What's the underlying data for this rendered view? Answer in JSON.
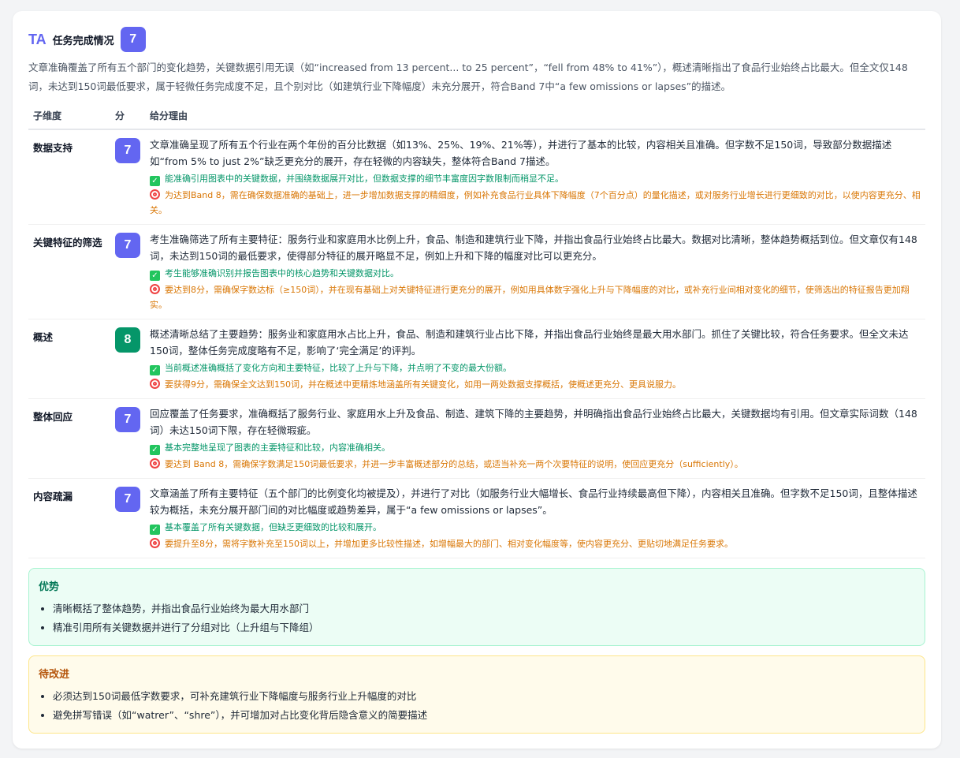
{
  "header": {
    "icon": "TA",
    "title": "任务完成情况",
    "score": "7"
  },
  "summary": "文章准确覆盖了所有五个部门的变化趋势，关键数据引用无误（如“increased from 13 percent... to 25 percent”，“fell from 48% to 41%”），概述清晰指出了食品行业始终占比最大。但全文仅148词，未达到150词最低要求，属于轻微任务完成度不足，且个别对比（如建筑行业下降幅度）未充分展开，符合Band 7中“a few omissions or lapses”的描述。",
  "table": {
    "columns": [
      "子维度",
      "分",
      "给分理由"
    ],
    "rows": [
      {
        "dimension": "数据支持",
        "score": "7",
        "reason": "文章准确呈现了所有五个行业在两个年份的百分比数据（如13%、25%、19%、21%等），并进行了基本的比较，内容相关且准确。但字数不足150词，导致部分数据描述如“from 5% to just 2%”缺乏更充分的展开，存在轻微的内容缺失，整体符合Band 7描述。",
        "strength": "能准确引用图表中的关键数据，并围绕数据展开对比，但数据支撑的细节丰富度因字数限制而稍显不足。",
        "tip": "为达到Band 8，需在确保数据准确的基础上，进一步增加数据支撑的精细度，例如补充食品行业具体下降幅度（7个百分点）的量化描述，或对服务行业增长进行更细致的对比，以使内容更充分、相关。"
      },
      {
        "dimension": "关键特征的筛选",
        "score": "7",
        "reason": "考生准确筛选了所有主要特征：服务行业和家庭用水比例上升，食品、制造和建筑行业下降，并指出食品行业始终占比最大。数据对比清晰，整体趋势概括到位。但文章仅有148词，未达到150词的最低要求，使得部分特征的展开略显不足，例如上升和下降的幅度对比可以更充分。",
        "strength": "考生能够准确识别并报告图表中的核心趋势和关键数据对比。",
        "tip": "要达到8分，需确保字数达标（≥150词），并在现有基础上对关键特征进行更充分的展开，例如用具体数字强化上升与下降幅度的对比，或补充行业间相对变化的细节，使筛选出的特征报告更加翔实。"
      },
      {
        "dimension": "概述",
        "score": "8",
        "reason": "概述清晰总结了主要趋势：服务业和家庭用水占比上升，食品、制造和建筑行业占比下降，并指出食品行业始终是最大用水部门。抓住了关键比较，符合任务要求。但全文未达150词，整体任务完成度略有不足，影响了‘完全满足’的评判。",
        "strength": "当前概述准确概括了变化方向和主要特征，比较了上升与下降，并点明了不变的最大份额。",
        "tip": "要获得9分，需确保全文达到150词，并在概述中更精炼地涵盖所有关键变化，如用一两处数据支撑概括，使概述更充分、更具说服力。"
      },
      {
        "dimension": "整体回应",
        "score": "7",
        "reason": "回应覆盖了任务要求，准确概括了服务行业、家庭用水上升及食品、制造、建筑下降的主要趋势，并明确指出食品行业始终占比最大，关键数据均有引用。但文章实际词数（148词）未达150词下限，存在轻微瑕疵。",
        "strength": "基本完整地呈现了图表的主要特征和比较，内容准确相关。",
        "tip": "要达到 Band 8，需确保字数满足150词最低要求，并进一步丰富概述部分的总结，或适当补充一两个次要特征的说明，使回应更充分（sufficiently）。"
      },
      {
        "dimension": "内容疏漏",
        "score": "7",
        "reason": "文章涵盖了所有主要特征（五个部门的比例变化均被提及），并进行了对比（如服务行业大幅增长、食品行业持续最高但下降），内容相关且准确。但字数不足150词，且整体描述较为概括，未充分展开部门间的对比幅度或趋势差异，属于“a few omissions or lapses”。",
        "strength": "基本覆盖了所有关键数据，但缺乏更细致的比较和展开。",
        "tip": "要提升至8分，需将字数补充至150词以上，并增加更多比较性描述，如增幅最大的部门、相对变化幅度等，使内容更充分、更贴切地满足任务要求。"
      }
    ]
  },
  "strengths": {
    "title": "优势",
    "items": [
      "清晰概括了整体趋势，并指出食品行业始终为最大用水部门",
      "精准引用所有关键数据并进行了分组对比（上升组与下降组）"
    ]
  },
  "improvements": {
    "title": "待改进",
    "items": [
      "必须达到150词最低字数要求，可补充建筑行业下降幅度与服务行业上升幅度的对比",
      "避免拼写错误（如“watrer”、“shre”），并可增加对占比变化背后隐含意义的简要描述"
    ]
  },
  "icons": {
    "strength_icon": "check-icon",
    "tip_icon": "target-icon"
  },
  "colors": {
    "accent": "#6366f1",
    "score_high": "#059669",
    "ok_text": "#059669",
    "tip_text": "#d97706"
  }
}
